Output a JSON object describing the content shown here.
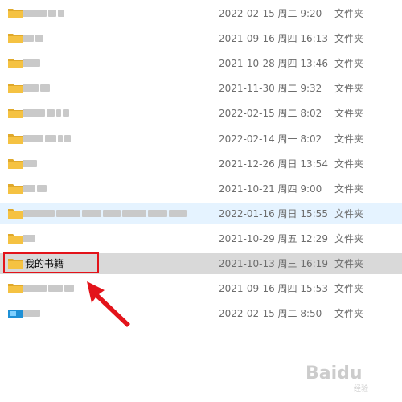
{
  "rows": [
    {
      "name": "",
      "date": "2022-02-15 周二 9:20",
      "type": "文件夹",
      "icon": "folder-icon",
      "blur": [
        30,
        10,
        8
      ]
    },
    {
      "name": "",
      "date": "2021-09-16 周四 16:13",
      "type": "文件夹",
      "icon": "folder-icon",
      "blur": [
        14,
        10
      ]
    },
    {
      "name": "",
      "date": "2021-10-28 周四 13:46",
      "type": "文件夹",
      "icon": "folder-icon",
      "blur": [
        22
      ]
    },
    {
      "name": "",
      "date": "2021-11-30 周二 9:32",
      "type": "文件夹",
      "icon": "folder-icon",
      "blur": [
        20,
        12
      ]
    },
    {
      "name": "",
      "date": "2022-02-15 周二 8:02",
      "type": "文件夹",
      "icon": "folder-icon",
      "blur": [
        28,
        10,
        6,
        8
      ]
    },
    {
      "name": "",
      "date": "2022-02-14 周一 8:02",
      "type": "文件夹",
      "icon": "folder-icon",
      "blur": [
        26,
        14,
        6,
        8
      ]
    },
    {
      "name": "",
      "date": "2021-12-26 周日 13:54",
      "type": "文件夹",
      "icon": "folder-icon",
      "blur": [
        18
      ]
    },
    {
      "name": "",
      "date": "2021-10-21 周四 9:00",
      "type": "文件夹",
      "icon": "folder-icon",
      "blur": [
        16,
        12
      ]
    },
    {
      "name": "",
      "date": "2022-01-16 周日 15:55",
      "type": "文件夹",
      "icon": "folder-icon",
      "blur": [
        40,
        30,
        24,
        22,
        30,
        24,
        22
      ]
    },
    {
      "name": "",
      "date": "2021-10-29 周五 12:29",
      "type": "文件夹",
      "icon": "folder-icon",
      "blur": [
        16
      ]
    },
    {
      "name": "我的书籍",
      "date": "2021-10-13 周三 16:19",
      "type": "文件夹",
      "icon": "folder-icon",
      "blur": []
    },
    {
      "name": "",
      "date": "2021-09-16 周四 15:53",
      "type": "文件夹",
      "icon": "folder-icon",
      "blur": [
        30,
        18,
        12
      ]
    },
    {
      "name": "",
      "date": "2022-02-15 周二 8:50",
      "type": "文件夹",
      "icon": "app-icon",
      "blur": [
        22
      ]
    }
  ],
  "hover_row": 8,
  "selected_row": 10,
  "watermark": {
    "main": "Baidu",
    "sub": "经验"
  },
  "colors": {
    "folder": "#f5c242",
    "folder_dark": "#e0a92b",
    "highlight": "#e3131a",
    "hover": "#e5f3ff",
    "selected": "#d9d9d9"
  }
}
